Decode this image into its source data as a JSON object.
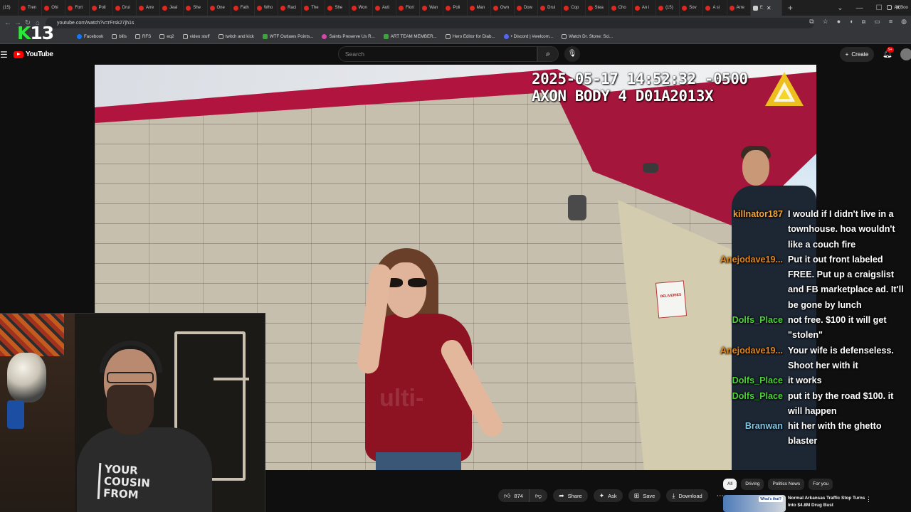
{
  "browser": {
    "tabs": [
      "(15)",
      "Tren",
      "Ohi",
      "Fort",
      "Poli",
      "Drui",
      "Arre",
      "Jeal",
      "She",
      "One",
      "Fath",
      "Who",
      "Raci",
      "The",
      "She",
      "Won",
      "Auti",
      "Flori",
      "Wan",
      "Poli",
      "Man",
      "Own",
      "Dow",
      "Drui",
      "Cop",
      "Stea",
      "Cho",
      "An i",
      "(15)",
      "Sov",
      "A si",
      "Arre"
    ],
    "active_tab": "E",
    "new_tab": "+",
    "url": "youtube.com/watch?v=rFrsk27jh1s",
    "bookmarks": [
      "Facebook",
      "bills",
      "RFS",
      "eq2",
      "video stuff",
      "twitch and kick",
      "WTF Outlaws Points...",
      "Saints Preserve Us R...",
      "ART TEAM MEMBER...",
      "Hero Editor for Diab...",
      "• Discord | #welcom...",
      "Watch Dr. Stone: Sci..."
    ],
    "bookmarks_more": "All Boo"
  },
  "overlay": {
    "logo_letter": "K",
    "logo_number": "13"
  },
  "youtube": {
    "logo_text": "YouTube",
    "search_placeholder": "Search",
    "create_label": "Create",
    "notification_count": "9+"
  },
  "video": {
    "timestamp_line1": "2025-05-17 14:52:32 -0500",
    "timestamp_line2": "AXON BODY 4 D01A2013X",
    "watermark": "ulti-",
    "door_sign": "DELIVERIES"
  },
  "webcam": {
    "shirt_text": "YOUR COUSIN FROM"
  },
  "chat": [
    {
      "user": "killnator187",
      "color": "#f2a33a",
      "text": "I would if I didn't live in a townhouse. hoa wouldn't like a couch fire"
    },
    {
      "user": "Anejodave19...",
      "color": "#e0861f",
      "text": "Put it out front labeled FREE. Put up a craigslist and FB marketplace ad. It'll be gone by lunch"
    },
    {
      "user": "Dolfs_Place",
      "color": "#4cd137",
      "text": "not free. $100 it will get \"stolen\""
    },
    {
      "user": "Anejodave19...",
      "color": "#e0861f",
      "text": "Your wife is defenseless. Shoot her with it"
    },
    {
      "user": "Dolfs_Place",
      "color": "#4cd137",
      "text": "it works"
    },
    {
      "user": "Dolfs_Place",
      "color": "#4cd137",
      "text": "put it by the road $100. it will happen"
    },
    {
      "user": "Branwan",
      "color": "#7fc8e8",
      "text": "hit her with the ghetto blaster"
    }
  ],
  "actions": {
    "like_count": "874",
    "share": "Share",
    "ask": "Ask",
    "save": "Save",
    "download": "Download"
  },
  "chips": [
    "All",
    "Driving",
    "Politics News",
    "For you"
  ],
  "recommendation": {
    "thumb_label": "What's that?",
    "title": "Normal Arkansas Traffic Stop Turns Into $4.8M Drug Bust"
  }
}
